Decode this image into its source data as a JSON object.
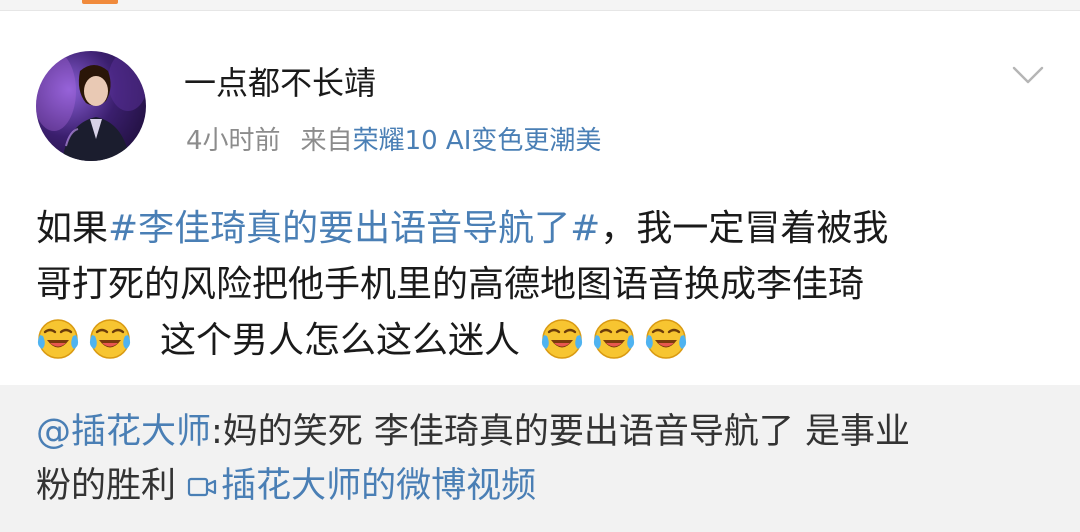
{
  "post": {
    "username": "一点都不长靖",
    "time": "4小时前",
    "source_label": "来自",
    "source_device": "荣耀10 AI变色更潮美",
    "avatar": "user-avatar-photo",
    "more_icon": "chevron-down-icon",
    "text": {
      "prefix": "如果",
      "hashtag": "#李佳琦真的要出语音导航了#",
      "after_hashtag": "，我一定冒着被我",
      "line2": "哥打死的风险把他手机里的高德地图语音换成李佳琦",
      "line3_text": "这个男人怎么这么迷人",
      "emoji": "laughing-crying-emoji"
    }
  },
  "comment": {
    "mention": "@插花大师",
    "text_line1": ":妈的笑死 李佳琦真的要出语音导航了 是事业",
    "text_line2": "粉的胜利",
    "video_link": "插花大师的微博视频",
    "video_icon": "video-icon"
  },
  "colors": {
    "link_blue": "#4a7fb5",
    "meta_gray": "#8c8c8c",
    "comment_bg": "#f2f2f2",
    "text": "#1a1a1a"
  }
}
